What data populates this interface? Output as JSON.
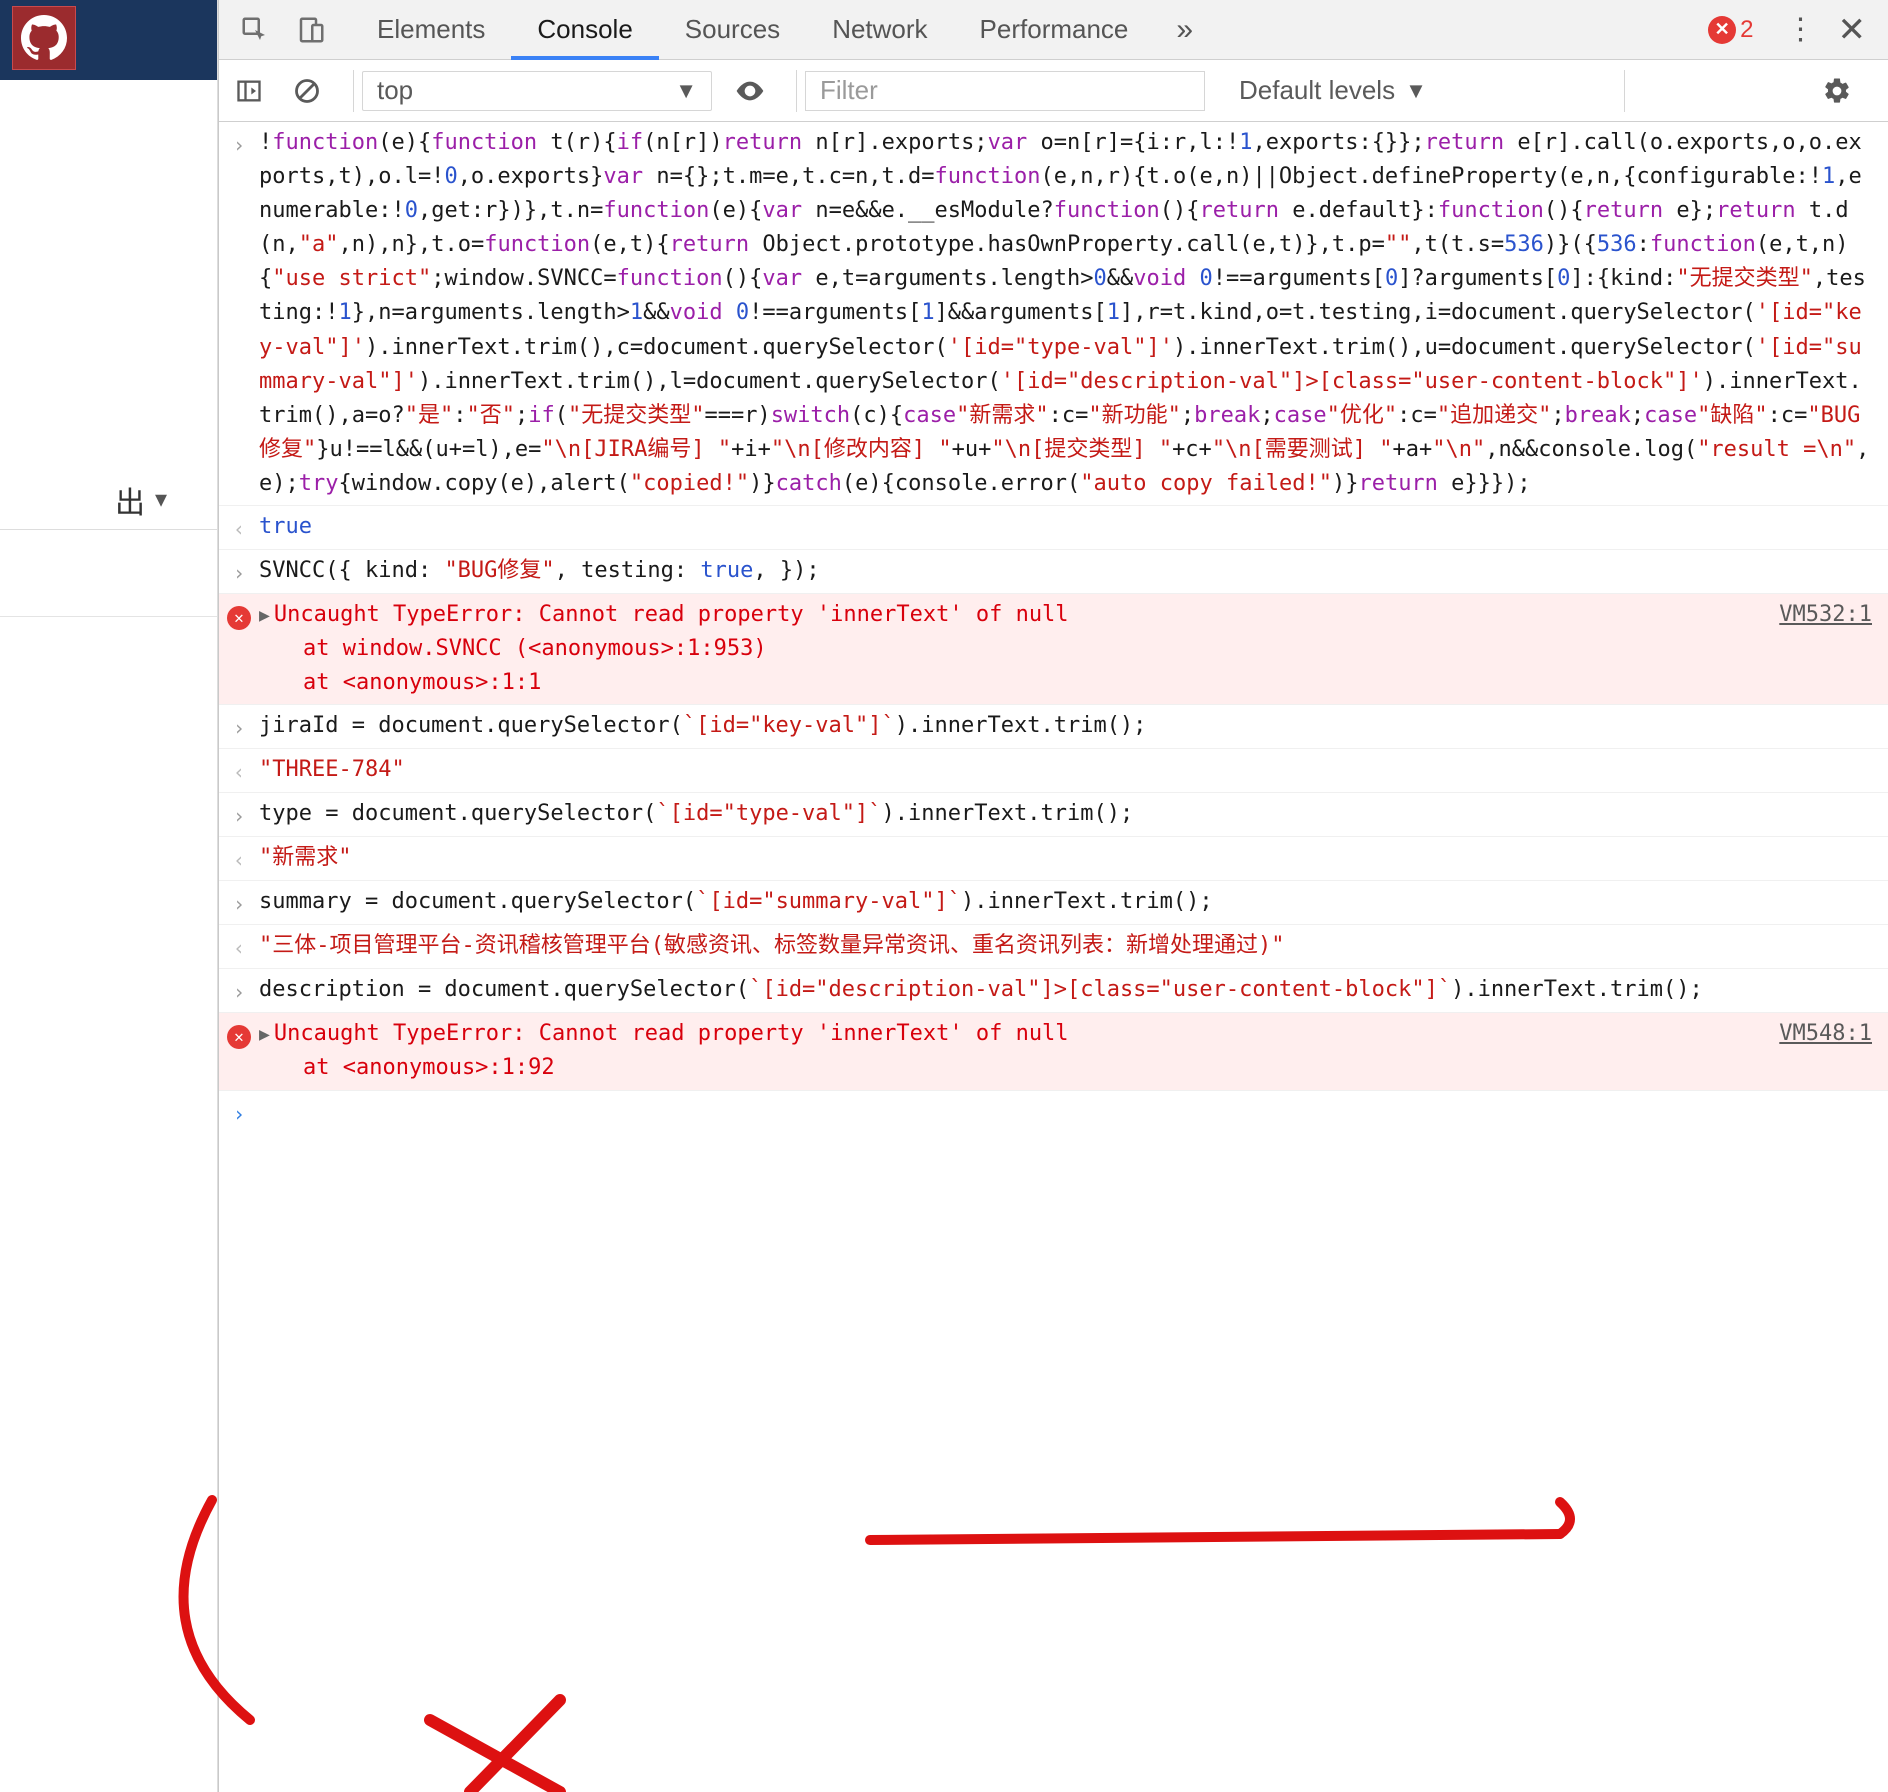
{
  "app": {
    "export_label": "出"
  },
  "tabs": {
    "elements": "Elements",
    "console": "Console",
    "sources": "Sources",
    "network": "Network",
    "performance": "Performance",
    "error_count": "2"
  },
  "toolbar": {
    "context": "top",
    "filter_placeholder": "Filter",
    "levels": "Default levels"
  },
  "rows": {
    "r0": "!function(e){function t(r){if(n[r])return n[r].exports;var o=n[r]={i:r,l:!1,exports:{}};return e[r].call(o.exports,o,o.exports,t),o.l=!0,o.exports}var n={};t.m=e,t.c=n,t.d=function(e,n,r){t.o(e,n)||Object.defineProperty(e,n,{configurable:!1,enumerable:!0,get:r})},t.n=function(e){var n=e&&e.__esModule?function(){return e.default}:function(){return e};return t.d(n,\"a\",n),n},t.o=function(e,t){return Object.prototype.hasOwnProperty.call(e,t)},t.p=\"\",t(t.s=536)}({536:function(e,t,n){\"use strict\";window.SVNCC=function(){var e,t=arguments.length>0&&void 0!==arguments[0]?arguments[0]:{kind:\"无提交类型\",testing:!1},n=arguments.length>1&&void 0!==arguments[1]&&arguments[1],r=t.kind,o=t.testing,i=document.querySelector('[id=\"key-val\"]').innerText.trim(),c=document.querySelector('[id=\"type-val\"]').innerText.trim(),u=document.querySelector('[id=\"summary-val\"]').innerText.trim(),l=document.querySelector('[id=\"description-val\"]>[class=\"user-content-block\"]').innerText.trim(),a=o?\"是\":\"否\";if(\"无提交类型\"===r)switch(c){case\"新需求\":c=\"新功能\";break;case\"优化\":c=\"追加递交\";break;case\"缺陷\":c=\"BUG修复\"}u!==l&&(u+=l),e=\"\\n[JIRA编号] \"+i+\"\\n[修改内容] \"+u+\"\\n[提交类型] \"+c+\"\\n[需要测试] \"+a+\"\\n\",n&&console.log(\"result =\\n\",e);try{window.copy(e),alert(\"copied!\")}catch(e){console.error(\"auto copy failed!\")}return e}}});",
    "r1": "true",
    "r2": "SVNCC({ kind: \"BUG修复\", testing: true, });",
    "e1_main": "Uncaught TypeError: Cannot read property 'innerText' of null",
    "e1_s1": "at window.SVNCC (<anonymous>:1:953)",
    "e1_s2": "at <anonymous>:1:1",
    "e1_src": "VM532:1",
    "r3": "jiraId = document.querySelector(`[id=\"key-val\"]`).innerText.trim();",
    "r4": "\"THREE-784\"",
    "r5": "type = document.querySelector(`[id=\"type-val\"]`).innerText.trim();",
    "r6": "\"新需求\"",
    "r7": "summary = document.querySelector(`[id=\"summary-val\"]`).innerText.trim();",
    "r8": "\"三体-项目管理平台-资讯稽核管理平台(敏感资讯、标签数量异常资讯、重名资讯列表：新增处理通过)\"",
    "r9": "description = document.querySelector(`[id=\"description-val\"]>[class=\"user-content-block\"]`).innerText.trim();",
    "e2_main": "Uncaught TypeError: Cannot read property 'innerText' of null",
    "e2_s1": "at <anonymous>:1:92",
    "e2_src": "VM548:1"
  }
}
